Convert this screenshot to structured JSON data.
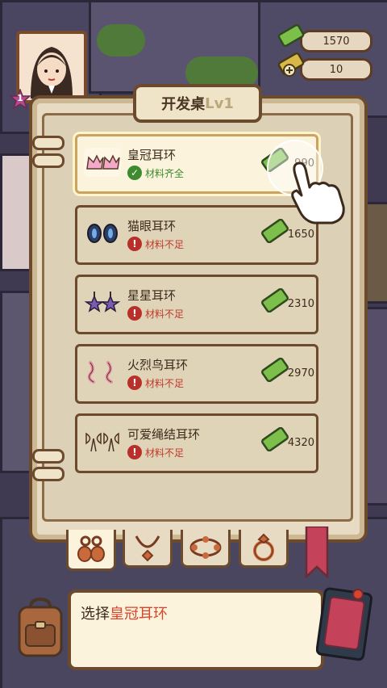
{
  "hud": {
    "level": "1",
    "resources": [
      {
        "value": "1570",
        "icon": "cash-icon"
      },
      {
        "value": "10",
        "icon": "cash-plus-icon"
      }
    ]
  },
  "panel": {
    "title": "开发桌",
    "level": "Lv1"
  },
  "items": [
    {
      "name": "皇冠耳环",
      "status": "材料齐全",
      "status_type": "ok",
      "price": "990",
      "icon": "crown-earrings-icon",
      "selected": true
    },
    {
      "name": "猫眼耳环",
      "status": "材料不足",
      "status_type": "bad",
      "price": "1650",
      "icon": "cat-eye-earrings-icon"
    },
    {
      "name": "星星耳环",
      "status": "材料不足",
      "status_type": "bad",
      "price": "2310",
      "icon": "star-earrings-icon"
    },
    {
      "name": "火烈鸟耳环",
      "status": "材料不足",
      "status_type": "bad",
      "price": "2970",
      "icon": "flamingo-earrings-icon"
    },
    {
      "name": "可爱绳结耳环",
      "status": "材料不足",
      "status_type": "bad",
      "price": "4320",
      "icon": "bow-earrings-icon"
    }
  ],
  "tabs": [
    {
      "icon": "earrings-tab-icon",
      "active": true
    },
    {
      "icon": "necklace-tab-icon"
    },
    {
      "icon": "bracelet-tab-icon"
    },
    {
      "icon": "ring-tab-icon"
    }
  ],
  "dialog": {
    "prefix": "选择",
    "highlight": "皇冠耳环"
  },
  "colors": {
    "frame": "#6c4a2e",
    "panel": "#e7dcc3",
    "ok": "#3d8a2f",
    "bad": "#c0392b",
    "highlight": "#d9452c",
    "cash": "#7cbf4a"
  }
}
